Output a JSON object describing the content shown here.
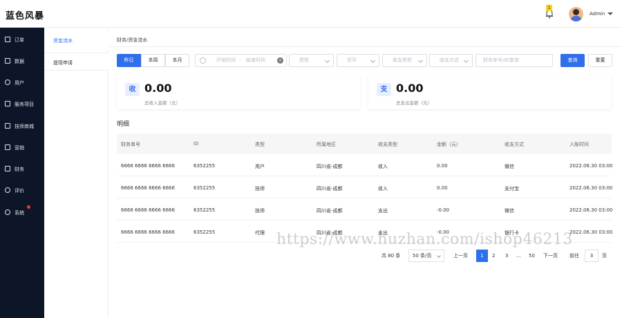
{
  "app": {
    "title": "蓝色风暴"
  },
  "header": {
    "notification_count": "1",
    "user_name": "Admin"
  },
  "sidebar": {
    "items": [
      {
        "label": "订单",
        "icon": "doc-icon"
      },
      {
        "label": "数据",
        "icon": "monitor-icon"
      },
      {
        "label": "用户",
        "icon": "user-icon"
      },
      {
        "label": "服务项目",
        "icon": "grid-icon"
      },
      {
        "label": "技师商城",
        "icon": "grid-icon"
      },
      {
        "label": "营销",
        "icon": "cart-icon"
      },
      {
        "label": "财务",
        "icon": "bar-chart-icon"
      },
      {
        "label": "评价",
        "icon": "target-icon"
      },
      {
        "label": "系统",
        "icon": "settings-icon"
      }
    ]
  },
  "subnav": {
    "items": [
      {
        "label": "资金流水"
      },
      {
        "label": "提现申请"
      }
    ]
  },
  "breadcrumb": "财务/资金流水",
  "filters": {
    "periods": [
      "昨日",
      "本周",
      "本月"
    ],
    "start_placeholder": "开始时间",
    "range_sep": "-",
    "end_placeholder": "结束时间",
    "type_placeholder": "类型",
    "currency_placeholder": "货币",
    "flow_type_placeholder": "收支类型",
    "method_placeholder": "收支方式",
    "search_placeholder": "财务单号/ID查询",
    "search_button": "查询",
    "reset_button": "重置"
  },
  "summary": [
    {
      "badge": "收",
      "amount": "0.00",
      "caption": "总收入金额（元）"
    },
    {
      "badge": "支",
      "amount": "0.00",
      "caption": "总支出金额（元）"
    }
  ],
  "section_title": "明细",
  "table": {
    "headers": [
      "财务单号",
      "ID",
      "类型",
      "所属地区",
      "收支类型",
      "金额（元）",
      "收支方式",
      "入账时间"
    ],
    "rows": [
      [
        "6666 6666 6666 6666",
        "6352255",
        "用户",
        "四川省-成都",
        "收入",
        "0.00",
        "微信",
        "2022.06.30 03:00"
      ],
      [
        "6666 6666 6666 6666",
        "6352255",
        "技师",
        "四川省-成都",
        "收入",
        "0.00",
        "支付宝",
        "2022.06.30 03:00"
      ],
      [
        "6666 6666 6666 6666",
        "6352255",
        "技师",
        "四川省-成都",
        "支出",
        "-0.00",
        "微信",
        "2022.06.30 03:00"
      ],
      [
        "6666 6666 6666 6666",
        "6352255",
        "代理",
        "四川省-成都",
        "支出",
        "-0.00",
        "银行卡",
        "2022.06.30 03:00"
      ]
    ]
  },
  "pagination": {
    "total": "共 80 条",
    "page_size": "50 条/页",
    "prev": "上一页",
    "pages": [
      "1",
      "2",
      "3",
      "...",
      "50"
    ],
    "next": "下一页",
    "goto_label": "前往",
    "goto_value": "3",
    "page_suffix": "页"
  },
  "watermark": "https://www.huzhan.com/ishop46213",
  "colors": {
    "accent": "#2f6feb",
    "sidebar": "#0d1628",
    "badge": "#f7d21a",
    "dot": "#e83a3a"
  }
}
